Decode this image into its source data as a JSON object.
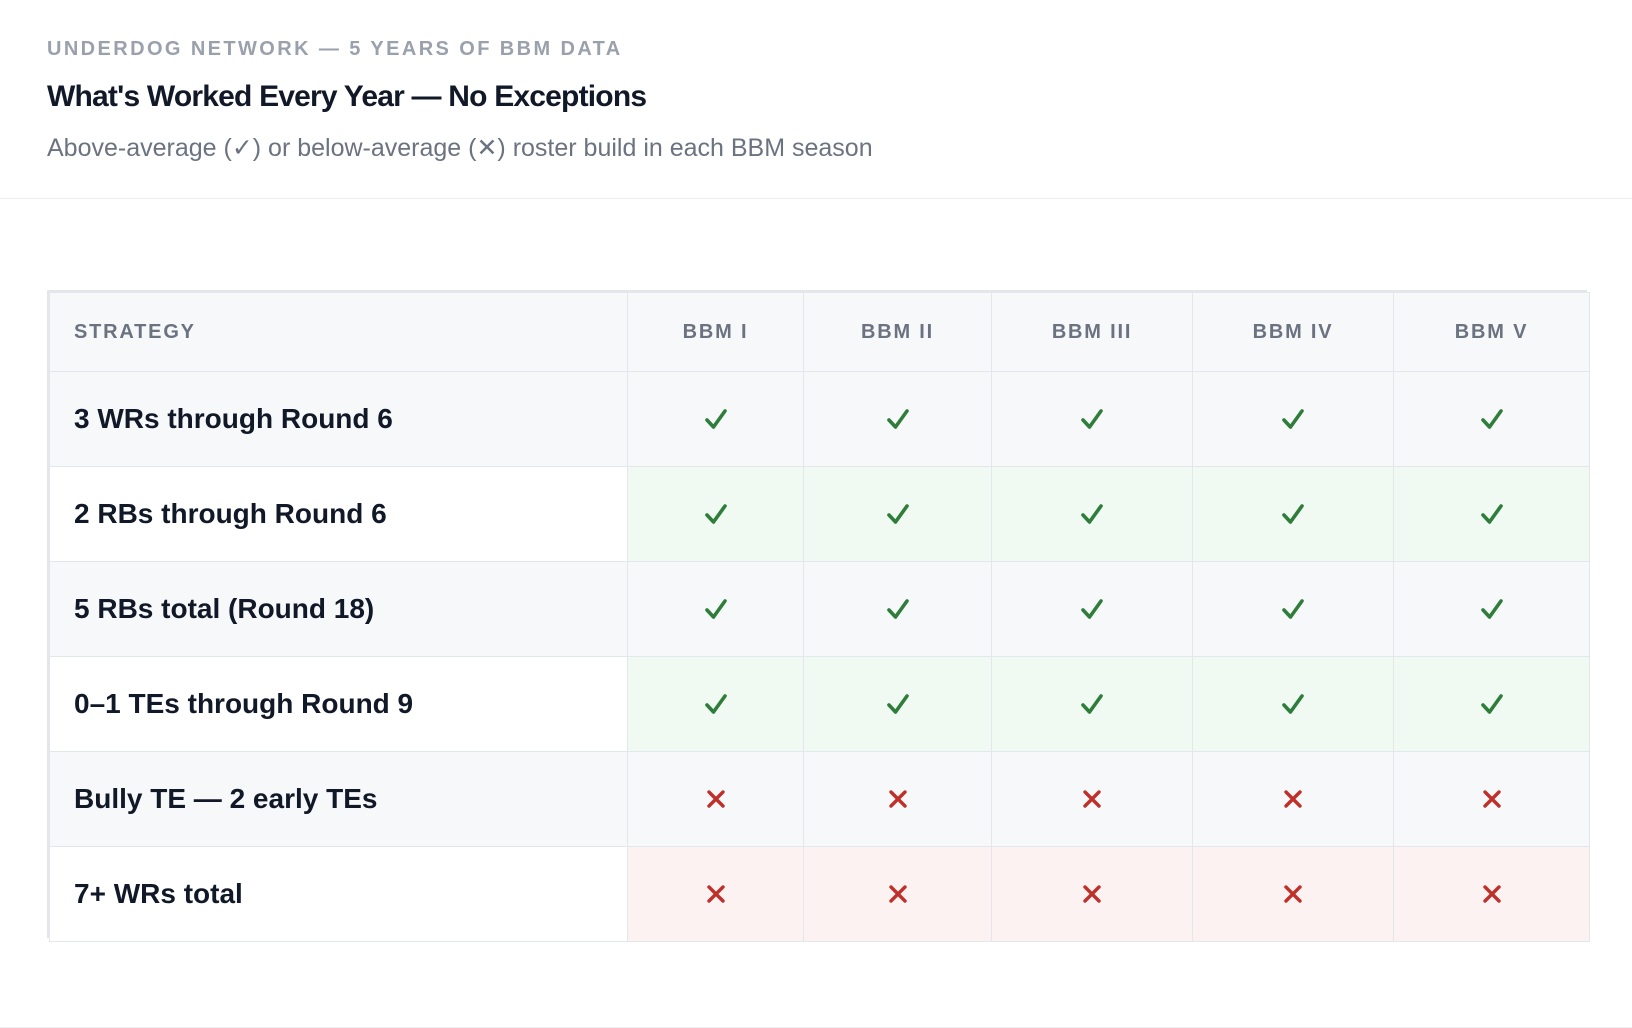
{
  "header": {
    "eyebrow": "UNDERDOG NETWORK — 5 YEARS OF BBM DATA",
    "title": "What's Worked Every Year — No Exceptions",
    "subtitle": "Above-average (✓) or below-average (✕) roster build in each BBM season"
  },
  "table": {
    "columns": [
      "STRATEGY",
      "BBM I",
      "BBM II",
      "BBM III",
      "BBM IV",
      "BBM V"
    ],
    "rows": [
      {
        "strategy": "3 WRs through Round 6",
        "results": [
          "check",
          "check",
          "check",
          "check",
          "check"
        ]
      },
      {
        "strategy": "2 RBs through Round 6",
        "results": [
          "check",
          "check",
          "check",
          "check",
          "check"
        ]
      },
      {
        "strategy": "5 RBs total (Round 18)",
        "results": [
          "check",
          "check",
          "check",
          "check",
          "check"
        ]
      },
      {
        "strategy": "0–1 TEs through Round 9",
        "results": [
          "check",
          "check",
          "check",
          "check",
          "check"
        ]
      },
      {
        "strategy": "Bully TE — 2 early TEs",
        "results": [
          "cross",
          "cross",
          "cross",
          "cross",
          "cross"
        ]
      },
      {
        "strategy": "7+ WRs total",
        "results": [
          "cross",
          "cross",
          "cross",
          "cross",
          "cross"
        ]
      }
    ]
  },
  "colors": {
    "check": "#2f7d3a",
    "cross": "#c0302a",
    "good_row_tint": "#f1faf2",
    "bad_row_tint": "#fcf2f2"
  }
}
